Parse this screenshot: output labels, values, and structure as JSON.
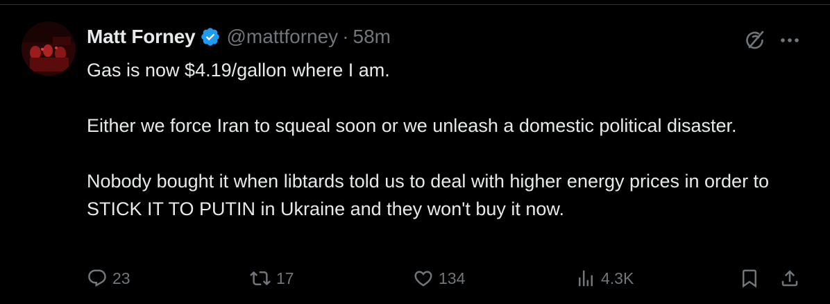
{
  "tweet": {
    "author_name": "Matt Forney",
    "handle": "@mattforney",
    "separator": "·",
    "time": "58m",
    "paragraphs": [
      "Gas is now $4.19/gallon where I am.",
      "Either we force Iran to squeal soon or we unleash a domestic political disaster.",
      "Nobody bought it when libtards told us to deal with higher energy prices in order to STICK IT TO PUTIN in Ukraine and they won't buy it now."
    ]
  },
  "actions": {
    "replies": "23",
    "reposts": "17",
    "likes": "134",
    "views": "4.3K"
  },
  "icons": {
    "verified": "verified-badge-icon",
    "grok": "grok-icon",
    "more": "more-icon",
    "reply": "reply-icon",
    "repost": "repost-icon",
    "like": "heart-icon",
    "views": "views-icon",
    "bookmark": "bookmark-icon",
    "share": "share-icon"
  },
  "colors": {
    "background": "#000000",
    "text": "#e7e9ea",
    "muted": "#71767b",
    "verified_blue": "#1d9bf0"
  }
}
